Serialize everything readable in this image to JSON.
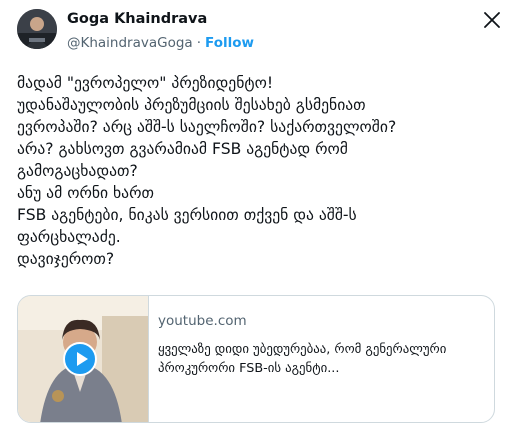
{
  "author": {
    "name": "Goga Khaindrava",
    "handle": "@KhaindravaGoga",
    "separator": "·",
    "follow_label": "Follow"
  },
  "tweet": {
    "lines": [
      "მადამ \"ევროპელო\" პრეზიდენტო!",
      "უდანაშაულობის პრეზუმციის შესახებ გსმენიათ",
      "ევროპაში? არც აშშ-ს საელჩოში?  საქართველოში?",
      "არა? გახსოვთ გვარამიამ FSB აგენტად რომ",
      "გამოგაცხადათ?",
      "ანუ ამ ორნი ხართ",
      "FSB აგენტები, ნიკას ვერსიით თქვენ და აშშ-ს",
      "ფარცხალაძე.",
      "დავიჯეროთ?"
    ]
  },
  "link_card": {
    "domain": "youtube.com",
    "title_lines": [
      "ყველაზე დიდი უბედურებაა, რომ გენერალური",
      "პროკურორი FSB-ის აგენტი..."
    ],
    "icons": {
      "play": "play-icon"
    }
  },
  "colors": {
    "accent": "#1d9bf0",
    "text": "#0f1419",
    "secondary": "#536471",
    "border": "#cfd9de"
  }
}
